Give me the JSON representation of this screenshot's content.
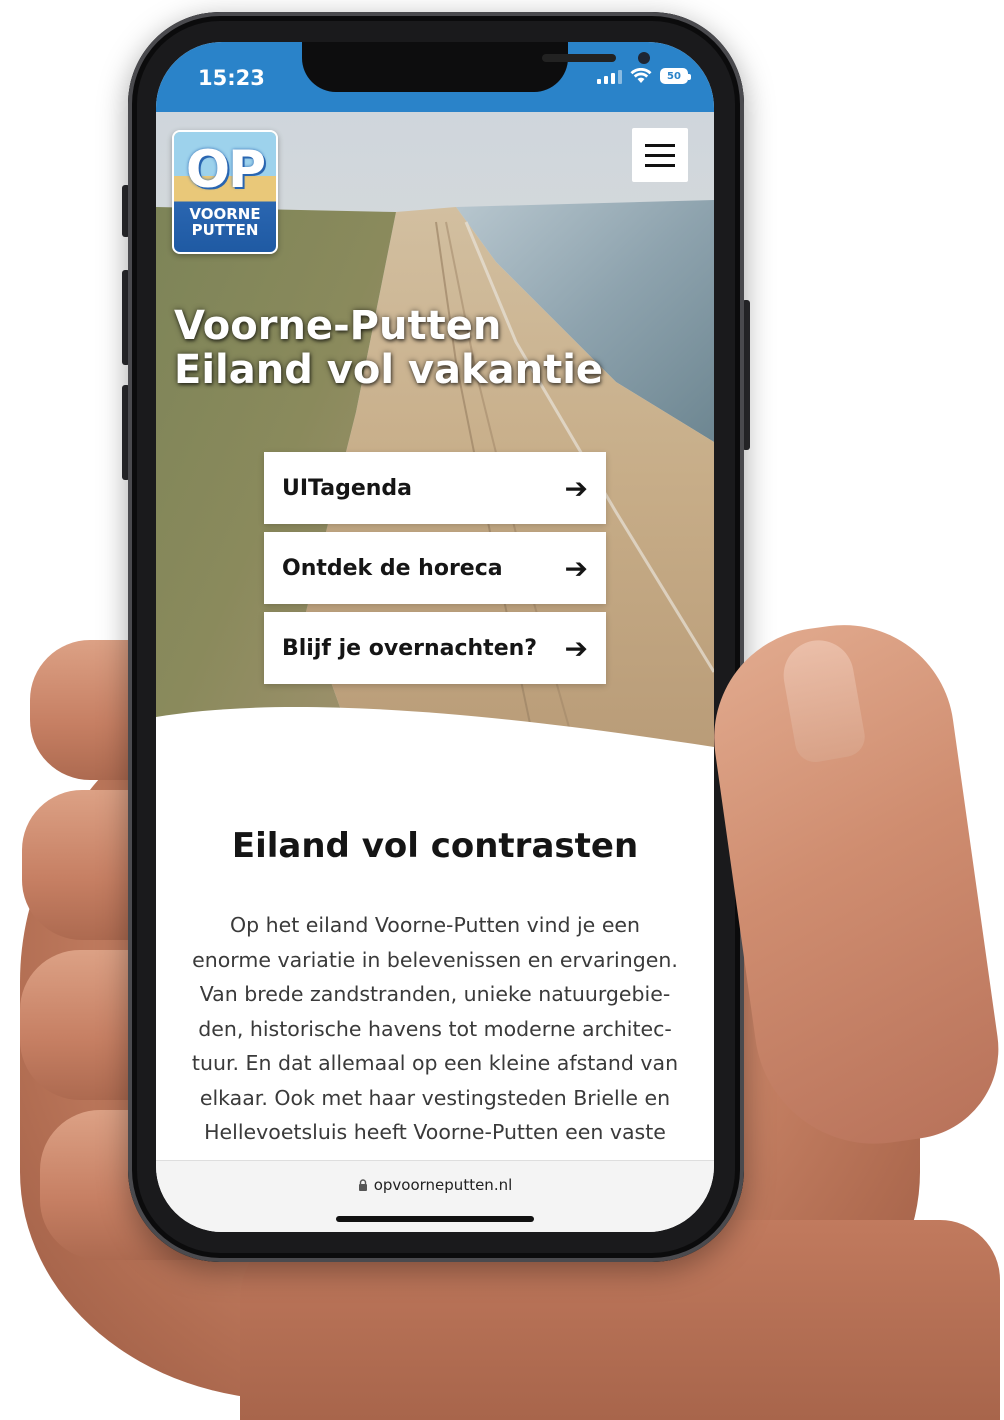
{
  "status_bar": {
    "time": "15:23",
    "battery": "50",
    "icons": [
      "signal-icon",
      "wifi-icon",
      "battery-icon"
    ]
  },
  "header": {
    "logo": {
      "line1": "OP",
      "line2": "VOORNE",
      "line3": "PUTTEN"
    },
    "menu_icon": "hamburger-menu-icon"
  },
  "hero": {
    "title_line1": "Voorne-Putten",
    "title_line2": "Eiland vol vakantie",
    "buttons": [
      {
        "label": "UITagenda",
        "icon": "arrow-right-icon"
      },
      {
        "label": "Ontdek de horeca",
        "icon": "arrow-right-icon"
      },
      {
        "label": "Blijf je overnachten?",
        "icon": "arrow-right-icon"
      }
    ]
  },
  "content": {
    "heading": "Eiland vol contrasten",
    "body_lines": [
      "Op het eiland Voorne-Putten vind je een",
      "enorme variatie in belevenissen en ervaringen.",
      "Van brede zandstranden, unieke natuurgebie-",
      "den, historische havens tot moderne architec-",
      "tuur. En dat allemaal op een kleine afstand van",
      "elkaar. Ook met haar vestingsteden Brielle en",
      "Hellevoetsluis heeft Voorne-Putten een vaste"
    ]
  },
  "browser": {
    "url": "opvoorneputten.nl",
    "lock_icon": "lock-icon"
  },
  "colors": {
    "statusbar": "#2a83c9",
    "logo_blue": "#2a66b1",
    "logo_sand": "#e9c879"
  }
}
